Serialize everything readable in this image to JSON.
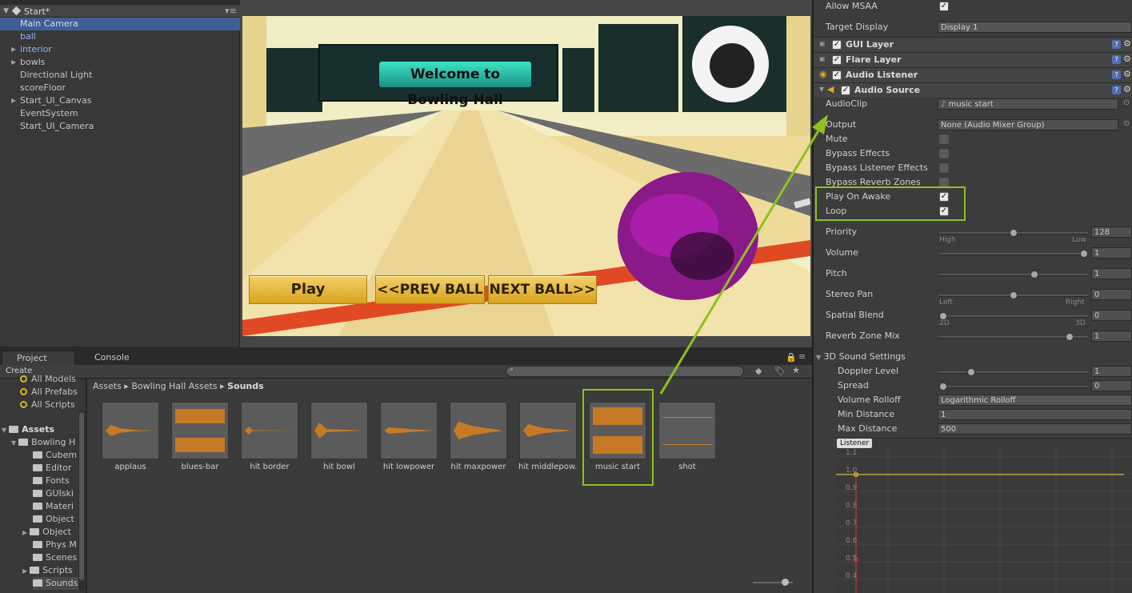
{
  "hierarchy": {
    "scene_name": "Start*",
    "items": [
      {
        "label": "Main Camera",
        "selected": true
      },
      {
        "label": "ball",
        "prefab": true
      },
      {
        "label": "interior",
        "prefab": true,
        "foldout": true
      },
      {
        "label": "bowls",
        "foldout": true
      },
      {
        "label": "Directional Light"
      },
      {
        "label": "scoreFloor"
      },
      {
        "label": "Start_UI_Canvas",
        "foldout": true
      },
      {
        "label": "EventSystem"
      },
      {
        "label": "Start_UI_Camera"
      }
    ]
  },
  "game": {
    "banner_text": "Welcome to Bowling Hall",
    "buttons": {
      "play": "Play",
      "prev": "<<PREV BALL",
      "next": "NEXT BALL>>"
    }
  },
  "project": {
    "tabs": [
      "Project",
      "Console"
    ],
    "create_label": "Create",
    "favorites": [
      "All Models",
      "All Prefabs",
      "All Scripts"
    ],
    "assets_label": "Assets",
    "folders": [
      {
        "label": "Bowling H",
        "level": 1,
        "foldout": "open"
      },
      {
        "label": "Cubem",
        "level": 2
      },
      {
        "label": "Editor",
        "level": 2
      },
      {
        "label": "Fonts",
        "level": 2
      },
      {
        "label": "GUIski",
        "level": 2
      },
      {
        "label": "Materi",
        "level": 2
      },
      {
        "label": "Object",
        "level": 2
      },
      {
        "label": "Object",
        "level": 2,
        "foldout": "closed"
      },
      {
        "label": "Phys M",
        "level": 2
      },
      {
        "label": "Scenes",
        "level": 2
      },
      {
        "label": "Scripts",
        "level": 2,
        "foldout": "closed"
      },
      {
        "label": "Sounds",
        "level": 2,
        "selected": true
      }
    ],
    "breadcrumb": [
      "Assets",
      "Bowling Hall Assets",
      "Sounds"
    ],
    "assets": [
      "applaus",
      "blues-bar",
      "hit border",
      "hit bowl",
      "hit lowpower",
      "hit maxpower",
      "hit middlepow...",
      "music start",
      "shot"
    ]
  },
  "inspector": {
    "allow_msaa": {
      "label": "Allow MSAA",
      "checked": true
    },
    "target_display": {
      "label": "Target Display",
      "value": "Display 1"
    },
    "components": [
      {
        "label": "GUI Layer",
        "enabled": true
      },
      {
        "label": "Flare Layer",
        "enabled": true
      },
      {
        "label": "Audio Listener",
        "enabled": true
      },
      {
        "label": "Audio Source",
        "enabled": true
      }
    ],
    "audio_source": {
      "audio_clip": {
        "label": "AudioClip",
        "value": "music start"
      },
      "output": {
        "label": "Output",
        "value": "None (Audio Mixer Group)"
      },
      "mute": {
        "label": "Mute",
        "checked": false
      },
      "bypass_effects": {
        "label": "Bypass Effects",
        "checked": false
      },
      "bypass_listener": {
        "label": "Bypass Listener Effects",
        "checked": false
      },
      "bypass_reverb": {
        "label": "Bypass Reverb Zones",
        "checked": false
      },
      "play_on_awake": {
        "label": "Play On Awake",
        "checked": true
      },
      "loop": {
        "label": "Loop",
        "checked": true
      },
      "priority": {
        "label": "Priority",
        "value": "128",
        "min_label": "High",
        "max_label": "Low",
        "fraction": 0.5
      },
      "volume": {
        "label": "Volume",
        "value": "1",
        "fraction": 1.0
      },
      "pitch": {
        "label": "Pitch",
        "value": "1",
        "fraction": 0.65
      },
      "stereo_pan": {
        "label": "Stereo Pan",
        "value": "0",
        "min_label": "Left",
        "max_label": "Right",
        "fraction": 0.5
      },
      "spatial_blend": {
        "label": "Spatial Blend",
        "value": "0",
        "min_label": "2D",
        "max_label": "3D",
        "fraction": 0.0
      },
      "reverb_mix": {
        "label": "Reverb Zone Mix",
        "value": "1",
        "fraction": 0.9
      }
    },
    "sound3d": {
      "header": "3D Sound Settings",
      "doppler": {
        "label": "Doppler Level",
        "value": "1",
        "fraction": 0.2
      },
      "spread": {
        "label": "Spread",
        "value": "0",
        "fraction": 0.0
      },
      "rolloff": {
        "label": "Volume Rolloff",
        "value": "Logarithmic Rolloff"
      },
      "min_distance": {
        "label": "Min Distance",
        "value": "1"
      },
      "max_distance": {
        "label": "Max Distance",
        "value": "500"
      }
    },
    "graph": {
      "badge": "Listener",
      "y_labels": [
        "1.1",
        "1.0",
        "0.9",
        "0.8",
        "0.7",
        "0.6",
        "0.5",
        "0.4"
      ]
    }
  },
  "colors": {
    "highlight": "#8dc21f",
    "selection": "#3e5f96",
    "wave": "#d17d1f"
  }
}
